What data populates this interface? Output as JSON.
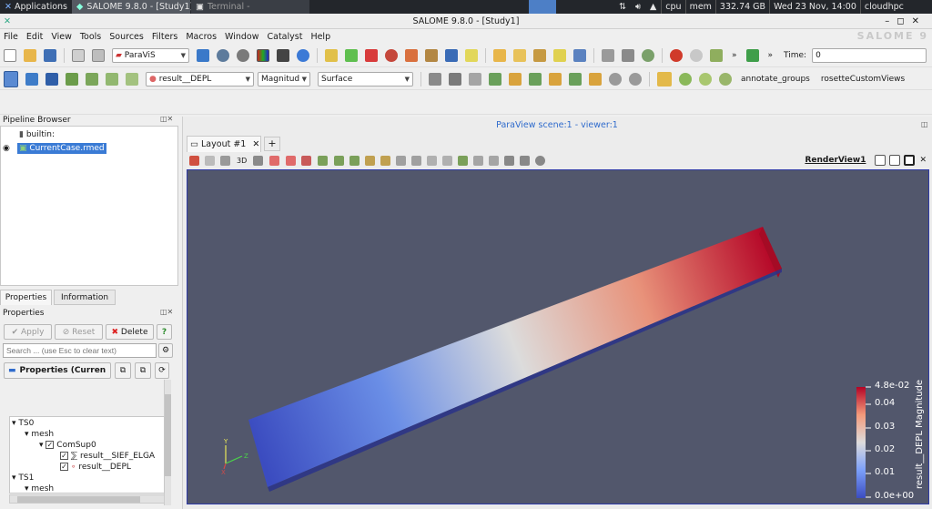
{
  "taskbar": {
    "applications": "Applications",
    "task1": "SALOME  9.8.0 - [Study1]",
    "task2": "Terminal -",
    "cpu": "cpu",
    "mem": "mem",
    "disk": "332.74 GB",
    "clock": "Wed 23 Nov, 14:00",
    "host": "cloudhpc"
  },
  "window": {
    "title": "SALOME  9.8.0 - [Study1]",
    "logo": "SALOME 9"
  },
  "menu": [
    "File",
    "Edit",
    "View",
    "Tools",
    "Sources",
    "Filters",
    "Macros",
    "Window",
    "Catalyst",
    "Help"
  ],
  "toolbar1": {
    "module": "ParaViS",
    "time_label": "Time:",
    "time_value": "0"
  },
  "toolbar2": {
    "array": "result__DEPL",
    "component": "Magnitud",
    "representation": "Surface",
    "plugin1": "annotate_groups",
    "plugin2": "rosetteCustomViews"
  },
  "pipeline": {
    "title": "Pipeline Browser",
    "items": [
      "builtin:",
      "CurrentCase.rmed"
    ]
  },
  "props": {
    "tabs": [
      "Properties",
      "Information"
    ],
    "title": "Properties",
    "apply": "Apply",
    "reset": "Reset",
    "delete": "Delete",
    "help": "?",
    "search_placeholder": "Search ... (use Esc to clear text)",
    "section": "Properties (Curren"
  },
  "tree": [
    "TS0",
    "mesh",
    "ComSup0",
    "result__SIEF_ELGA",
    "result__DEPL",
    "TS1",
    "mesh"
  ],
  "view": {
    "scene_title": "ParaView scene:1 - viewer:1",
    "layout_tab": "Layout #1",
    "three_d": "3D",
    "render_view": "RenderView1"
  },
  "legend": {
    "title": "result__DEPL Magnitude",
    "ticks": [
      "4.8e-02",
      "0.04",
      "0.03",
      "0.02",
      "0.01",
      "0.0e+00"
    ],
    "min": 0.0,
    "max": 0.048
  },
  "colors": {
    "accent": "#2f6bcc",
    "low": "#3b4cc0",
    "mid": "#dddcdc",
    "high": "#b40426"
  }
}
